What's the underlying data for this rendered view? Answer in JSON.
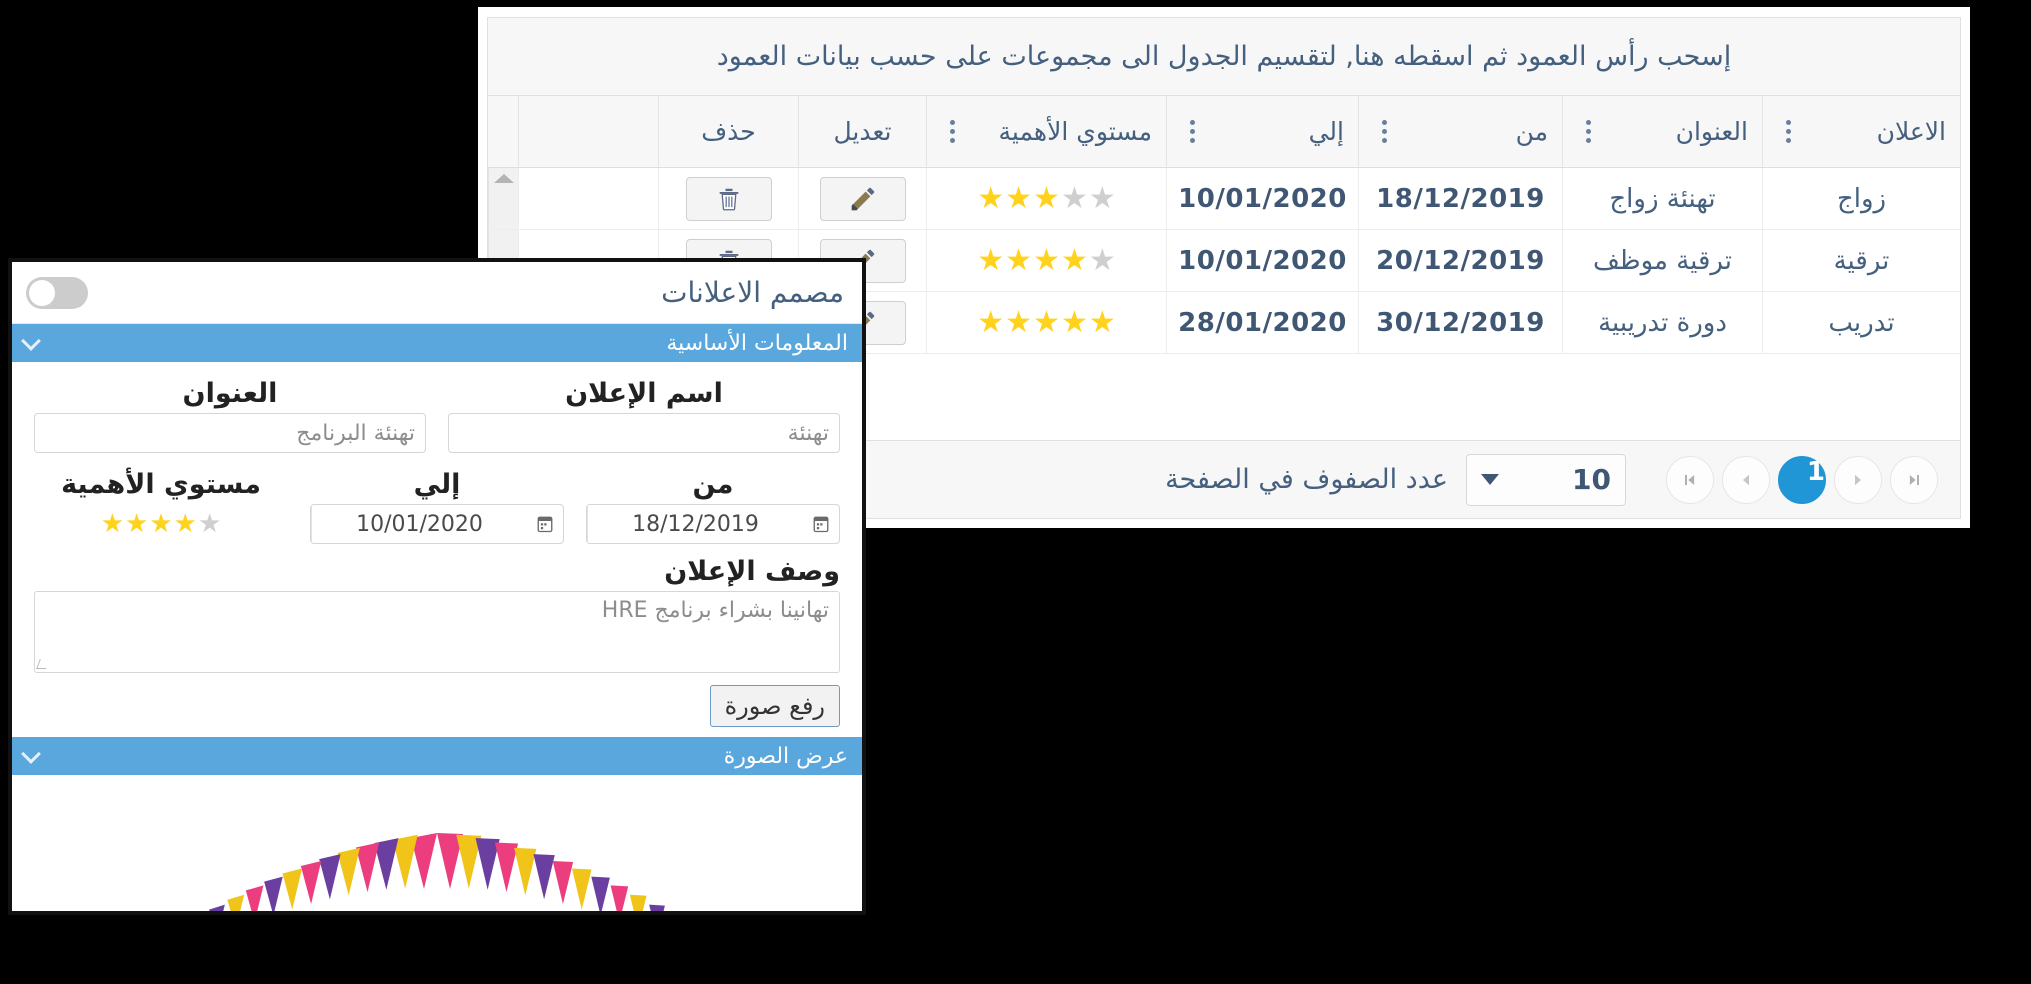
{
  "grid": {
    "group_hint": "إسحب رأس العمود ثم اسقطه هنا, لتقسيم الجدول الى مجموعات على حسب بيانات العمود",
    "columns": [
      {
        "label": "الاعلان",
        "key": "ad",
        "menu": true
      },
      {
        "label": "العنوان",
        "key": "title",
        "menu": true
      },
      {
        "label": "من",
        "key": "from",
        "menu": true
      },
      {
        "label": "إلي",
        "key": "to",
        "menu": true
      },
      {
        "label": "مستوي الأهمية",
        "key": "rating",
        "menu": true
      },
      {
        "label": "تعديل",
        "key": "edit",
        "menu": false
      },
      {
        "label": "حذف",
        "key": "delete",
        "menu": false
      }
    ],
    "rows": [
      {
        "ad": "زواج",
        "title": "تهنئة زواج",
        "from": "18/12/2019",
        "to": "10/01/2020",
        "rating": 3,
        "rating_max": 5,
        "edit_icon": "pencil-icon",
        "delete_icon": "trash-icon"
      },
      {
        "ad": "ترقية",
        "title": "ترقية موظف",
        "from": "20/12/2019",
        "to": "10/01/2020",
        "rating": 4,
        "rating_max": 5,
        "edit_icon": "pencil-icon",
        "delete_icon": "trash-icon"
      },
      {
        "ad": "تدريب",
        "title": "دورة تدريبية",
        "from": "30/12/2019",
        "to": "28/01/2020",
        "rating": 5,
        "rating_max": 5,
        "edit_icon": "pencil-icon",
        "delete_icon": "trash-icon"
      }
    ],
    "footer": {
      "rows_per_page_label": "عدد الصفوف في الصفحة",
      "rows_per_page_value": "10",
      "pages": [
        "1"
      ],
      "active_page": "1",
      "nav": {
        "first": "first-page-icon",
        "prev": "prev-page-icon",
        "next": "next-page-icon",
        "last": "last-page-icon"
      }
    }
  },
  "dialog": {
    "title": "مصمم الاعلانات",
    "toggle_state": "off",
    "sections": {
      "basic": "المعلومات الأساسية",
      "image": "عرض الصورة"
    },
    "fields": {
      "ad_name_label": "اسم الإعلان",
      "ad_name_value": "تهنئة",
      "title_label": "العنوان",
      "title_value": "تهنئة البرنامج",
      "from_label": "من",
      "from_value": "18/12/2019",
      "to_label": "إلي",
      "to_value": "10/01/2020",
      "rating_label": "مستوي الأهمية",
      "rating_value": 4,
      "rating_max": 5,
      "desc_label": "وصف الإعلان",
      "desc_value": "تهانينا بشراء برنامج HRE",
      "upload_button": "رفع صورة"
    }
  },
  "colors": {
    "section_blue": "#5aa7dd",
    "pager_active": "#2196d6",
    "star_on": "#ffd21e",
    "star_off": "#cfcfcf",
    "header_text": "#45607f",
    "bunting_pink": "#ec3e7f",
    "bunting_yellow": "#f0c419",
    "bunting_purple": "#6b3fa0"
  }
}
